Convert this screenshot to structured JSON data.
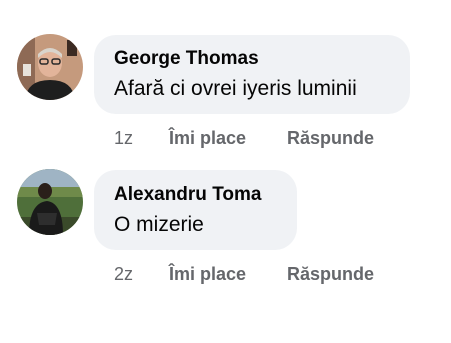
{
  "comments": [
    {
      "author": "George Thomas",
      "text": "Afară ci ovrei iyeris luminii",
      "time": "1z",
      "like_label": "Îmi place",
      "reply_label": "Răspunde"
    },
    {
      "author": "Alexandru Toma",
      "text": "O mizerie",
      "time": "2z",
      "like_label": "Îmi place",
      "reply_label": "Răspunde"
    }
  ],
  "colors": {
    "bubble_bg": "#f0f2f5",
    "primary_text": "#050505",
    "secondary_text": "#65676b"
  }
}
